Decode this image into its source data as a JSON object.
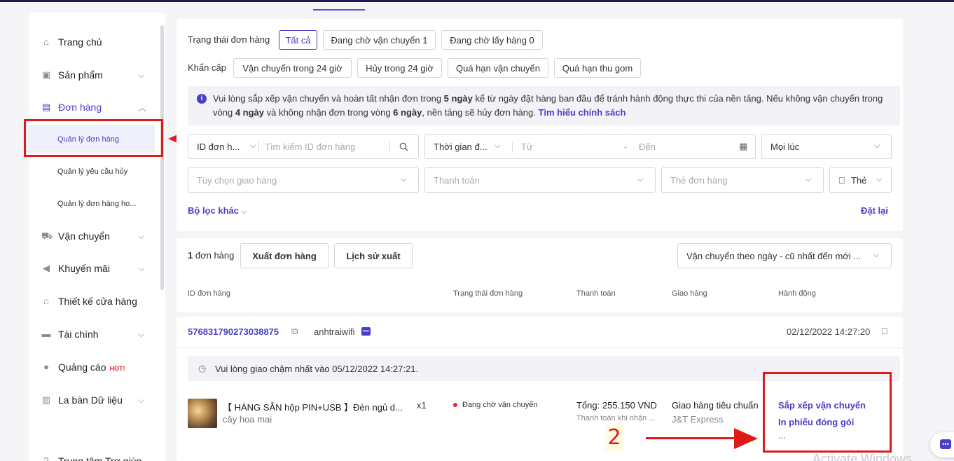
{
  "sidebar": {
    "items": [
      {
        "label": "Trang chủ",
        "icon": "home-icon",
        "glyph": "⌂"
      },
      {
        "label": "Sản phẩm",
        "icon": "product-icon",
        "glyph": "▣"
      },
      {
        "label": "Đơn hàng",
        "icon": "order-icon",
        "glyph": "▤"
      },
      {
        "label": "Vận chuyển",
        "icon": "truck-icon",
        "glyph": "⛟"
      },
      {
        "label": "Khuyến mãi",
        "icon": "megaphone-icon",
        "glyph": "◀"
      },
      {
        "label": "Thiết kế cửa hàng",
        "icon": "store-icon",
        "glyph": "⌂"
      },
      {
        "label": "Tài chính",
        "icon": "card-icon",
        "glyph": "▬"
      },
      {
        "label": "Quảng cáo",
        "icon": "ad-icon",
        "glyph": "●",
        "badge": "HOT!"
      },
      {
        "label": "La bàn Dữ liệu",
        "icon": "chart-icon",
        "glyph": "▥"
      },
      {
        "label": "Trung tâm Trợ giúp",
        "icon": "help-icon",
        "glyph": "?"
      }
    ],
    "subitems": [
      "Quản lý đơn hàng",
      "Quản lý yêu cầu hủy",
      "Quản lý đơn hàng ho..."
    ]
  },
  "filters": {
    "status_label": "Trạng thái đơn hàng",
    "status_chips": [
      "Tất cả",
      "Đang chờ vận chuyển 1",
      "Đang chờ lấy hàng 0"
    ],
    "urgent_label": "Khẩn cấp",
    "urgent_chips": [
      "Vận chuyển trong 24 giờ",
      "Hủy trong 24 giờ",
      "Quá hạn vận chuyển",
      "Quá hạn thu gom"
    ]
  },
  "notice": {
    "p1": "Vui lòng sắp xếp vận chuyển và hoàn tất nhận đơn trong ",
    "b1": "5 ngày",
    "p2": " kể từ ngày đặt hàng ban đầu để tránh hành động thực thi của nền tảng. Nếu không vận chuyển trong vòng ",
    "b2": "4 ngày",
    "p3": " và không nhận đơn trong vòng ",
    "b3": "6 ngày",
    "p4": ", nền tảng sẽ hủy đơn hàng. ",
    "link": "Tìm hiểu chính sách"
  },
  "search": {
    "id_select": "ID đơn h...",
    "id_placeholder": "Tìm kiếm ID đơn hàng",
    "time_select": "Thời gian đ...",
    "from": "Từ",
    "dash": "-",
    "to": "Đến",
    "period": "Mọi lúc",
    "delivery_option": "Tùy chọn giao hàng",
    "payment": "Thanh toán",
    "order_tag": "Thẻ đơn hàng",
    "tag_button": "Thẻ",
    "more_filters": "Bộ lọc khác",
    "reset": "Đặt lại"
  },
  "list": {
    "count_num": "1",
    "count_text": "đơn hàng",
    "export": "Xuất đơn hàng",
    "export_history": "Lịch sử xuất",
    "sort": "Vận chuyển theo ngày - cũ nhất đến mới ...",
    "headers": [
      "ID đơn hàng",
      "Trạng thái đơn hàng",
      "Thanh toán",
      "Giao hàng",
      "Hành động"
    ]
  },
  "order": {
    "id": "576831790273038875",
    "buyer": "anhtraiwifi",
    "date": "02/12/2022 14:27:20",
    "deadline": "Vui lòng giao chậm nhất vào 05/12/2022 14:27:21.",
    "product_name": "【 HÀNG SẴN hộp PIN+USB 】Đèn ngủ d...",
    "qty": "x1",
    "variant": "cây hoa mai",
    "status": "Đang chờ vận chuyển",
    "total": "Tổng: 255.150 VND",
    "payment_method": "Thanh toán khi nhận ...",
    "shipping": "Giao hàng tiêu chuẩn",
    "carrier": "J&T Express",
    "actions": [
      "Sắp xếp vận chuyển",
      "In phiếu đóng gói",
      "..."
    ]
  },
  "annotation": {
    "step_number": "2"
  },
  "watermark": "Activate Windows",
  "colors": {
    "accent": "#4a3fc7",
    "annotation_red": "#e01919",
    "status_red": "#e8242b"
  }
}
